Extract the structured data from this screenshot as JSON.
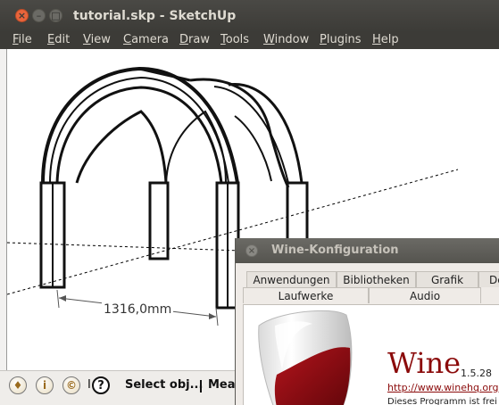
{
  "window": {
    "title": "tutorial.skp - SketchUp"
  },
  "menu": [
    {
      "label": "File",
      "underline": "F",
      "rest": "ile"
    },
    {
      "label": "Edit",
      "underline": "E",
      "rest": "dit"
    },
    {
      "label": "View",
      "underline": "V",
      "rest": "iew"
    },
    {
      "label": "Camera",
      "underline": "C",
      "rest": "amera"
    },
    {
      "label": "Draw",
      "underline": "D",
      "rest": "raw"
    },
    {
      "label": "Tools",
      "underline": "T",
      "rest": "ools"
    },
    {
      "label": "Window",
      "underline": "W",
      "rest": "indow"
    },
    {
      "label": "Plugins",
      "underline": "P",
      "rest": "lugins"
    },
    {
      "label": "Help",
      "underline": "H",
      "rest": "elp"
    }
  ],
  "viewport": {
    "dimension_label": "1316,0mm"
  },
  "status": {
    "prompt": "Select obj...",
    "measurements_label": "Meas",
    "icons": [
      "geo-location-icon",
      "credits-icon",
      "user-status-icon",
      "help-icon"
    ],
    "help_glyph": "?",
    "marker": "I"
  },
  "wine": {
    "title": "Wine-Konfiguration",
    "tabs_row1": [
      "Anwendungen",
      "Bibliotheken",
      "Grafik",
      "De"
    ],
    "tabs_row2": [
      "Laufwerke",
      "Audio"
    ],
    "name": "Wine",
    "version": "1.5.28",
    "link": "http://www.winehq.org",
    "description": "Dieses Programm ist frei"
  },
  "colors": {
    "wine_red": "#8b0b0b",
    "ubuntu_close": "#e9643b",
    "titlebar": "#3c3b37"
  }
}
